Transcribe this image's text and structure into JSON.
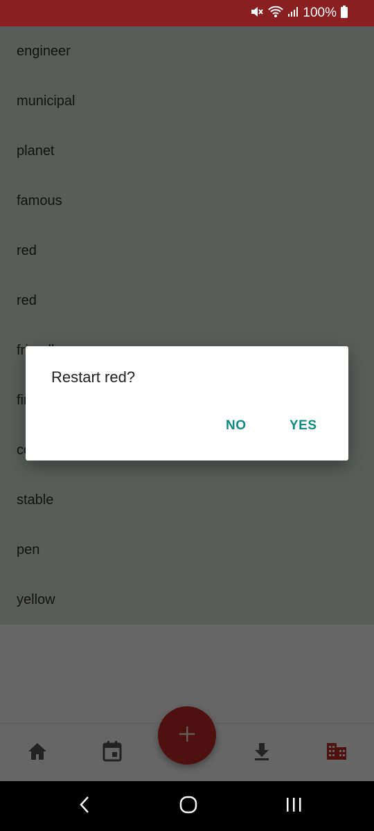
{
  "status_bar": {
    "battery_text": "100%",
    "icons": [
      "mute-icon",
      "wifi-icon",
      "signal-icon",
      "battery-icon"
    ]
  },
  "list": {
    "items": [
      "engineer",
      "municipal",
      "planet",
      "famous",
      "red",
      "red",
      "friendly",
      "first",
      "comb",
      "stable",
      "pen",
      "yellow"
    ]
  },
  "dialog": {
    "title": "Restart red?",
    "no_label": "NO",
    "yes_label": "YES"
  },
  "bottom_nav": {
    "items": [
      "home-icon",
      "calendar-icon",
      "download-icon",
      "building-icon"
    ],
    "active": "building-icon",
    "fab_icon": "plus-icon"
  },
  "system_nav": {
    "items": [
      "back-icon",
      "home-circle-icon",
      "recents-icon"
    ]
  },
  "colors": {
    "status_bar": "#8a1f1f",
    "accent": "#c62828",
    "dialog_button": "#0e8c80",
    "list_background": "#dce8e1"
  }
}
